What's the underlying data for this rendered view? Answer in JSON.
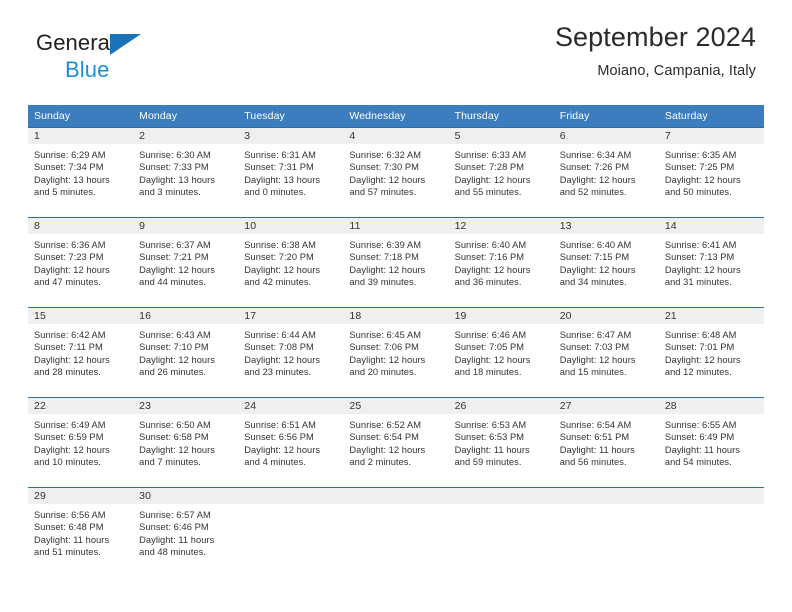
{
  "brand": {
    "name_part1": "General",
    "name_part2": "Blue",
    "triangle_color": "#1a72b8",
    "blue_text_color": "#1a8fdc"
  },
  "header": {
    "title": "September 2024",
    "subtitle": "Moiano, Campania, Italy"
  },
  "theme": {
    "header_bg": "#3c7dbf",
    "row_border": "#2e6da4",
    "daynum_bg": "#efefef",
    "text": "#333333"
  },
  "columns": [
    "Sunday",
    "Monday",
    "Tuesday",
    "Wednesday",
    "Thursday",
    "Friday",
    "Saturday"
  ],
  "labels": {
    "sunrise": "Sunrise:",
    "sunset": "Sunset:",
    "daylight": "Daylight:"
  },
  "weeks": [
    [
      {
        "day": "1",
        "sunrise": "Sunrise: 6:29 AM",
        "sunset": "Sunset: 7:34 PM",
        "daylight1": "Daylight: 13 hours",
        "daylight2": "and 5 minutes."
      },
      {
        "day": "2",
        "sunrise": "Sunrise: 6:30 AM",
        "sunset": "Sunset: 7:33 PM",
        "daylight1": "Daylight: 13 hours",
        "daylight2": "and 3 minutes."
      },
      {
        "day": "3",
        "sunrise": "Sunrise: 6:31 AM",
        "sunset": "Sunset: 7:31 PM",
        "daylight1": "Daylight: 13 hours",
        "daylight2": "and 0 minutes."
      },
      {
        "day": "4",
        "sunrise": "Sunrise: 6:32 AM",
        "sunset": "Sunset: 7:30 PM",
        "daylight1": "Daylight: 12 hours",
        "daylight2": "and 57 minutes."
      },
      {
        "day": "5",
        "sunrise": "Sunrise: 6:33 AM",
        "sunset": "Sunset: 7:28 PM",
        "daylight1": "Daylight: 12 hours",
        "daylight2": "and 55 minutes."
      },
      {
        "day": "6",
        "sunrise": "Sunrise: 6:34 AM",
        "sunset": "Sunset: 7:26 PM",
        "daylight1": "Daylight: 12 hours",
        "daylight2": "and 52 minutes."
      },
      {
        "day": "7",
        "sunrise": "Sunrise: 6:35 AM",
        "sunset": "Sunset: 7:25 PM",
        "daylight1": "Daylight: 12 hours",
        "daylight2": "and 50 minutes."
      }
    ],
    [
      {
        "day": "8",
        "sunrise": "Sunrise: 6:36 AM",
        "sunset": "Sunset: 7:23 PM",
        "daylight1": "Daylight: 12 hours",
        "daylight2": "and 47 minutes."
      },
      {
        "day": "9",
        "sunrise": "Sunrise: 6:37 AM",
        "sunset": "Sunset: 7:21 PM",
        "daylight1": "Daylight: 12 hours",
        "daylight2": "and 44 minutes."
      },
      {
        "day": "10",
        "sunrise": "Sunrise: 6:38 AM",
        "sunset": "Sunset: 7:20 PM",
        "daylight1": "Daylight: 12 hours",
        "daylight2": "and 42 minutes."
      },
      {
        "day": "11",
        "sunrise": "Sunrise: 6:39 AM",
        "sunset": "Sunset: 7:18 PM",
        "daylight1": "Daylight: 12 hours",
        "daylight2": "and 39 minutes."
      },
      {
        "day": "12",
        "sunrise": "Sunrise: 6:40 AM",
        "sunset": "Sunset: 7:16 PM",
        "daylight1": "Daylight: 12 hours",
        "daylight2": "and 36 minutes."
      },
      {
        "day": "13",
        "sunrise": "Sunrise: 6:40 AM",
        "sunset": "Sunset: 7:15 PM",
        "daylight1": "Daylight: 12 hours",
        "daylight2": "and 34 minutes."
      },
      {
        "day": "14",
        "sunrise": "Sunrise: 6:41 AM",
        "sunset": "Sunset: 7:13 PM",
        "daylight1": "Daylight: 12 hours",
        "daylight2": "and 31 minutes."
      }
    ],
    [
      {
        "day": "15",
        "sunrise": "Sunrise: 6:42 AM",
        "sunset": "Sunset: 7:11 PM",
        "daylight1": "Daylight: 12 hours",
        "daylight2": "and 28 minutes."
      },
      {
        "day": "16",
        "sunrise": "Sunrise: 6:43 AM",
        "sunset": "Sunset: 7:10 PM",
        "daylight1": "Daylight: 12 hours",
        "daylight2": "and 26 minutes."
      },
      {
        "day": "17",
        "sunrise": "Sunrise: 6:44 AM",
        "sunset": "Sunset: 7:08 PM",
        "daylight1": "Daylight: 12 hours",
        "daylight2": "and 23 minutes."
      },
      {
        "day": "18",
        "sunrise": "Sunrise: 6:45 AM",
        "sunset": "Sunset: 7:06 PM",
        "daylight1": "Daylight: 12 hours",
        "daylight2": "and 20 minutes."
      },
      {
        "day": "19",
        "sunrise": "Sunrise: 6:46 AM",
        "sunset": "Sunset: 7:05 PM",
        "daylight1": "Daylight: 12 hours",
        "daylight2": "and 18 minutes."
      },
      {
        "day": "20",
        "sunrise": "Sunrise: 6:47 AM",
        "sunset": "Sunset: 7:03 PM",
        "daylight1": "Daylight: 12 hours",
        "daylight2": "and 15 minutes."
      },
      {
        "day": "21",
        "sunrise": "Sunrise: 6:48 AM",
        "sunset": "Sunset: 7:01 PM",
        "daylight1": "Daylight: 12 hours",
        "daylight2": "and 12 minutes."
      }
    ],
    [
      {
        "day": "22",
        "sunrise": "Sunrise: 6:49 AM",
        "sunset": "Sunset: 6:59 PM",
        "daylight1": "Daylight: 12 hours",
        "daylight2": "and 10 minutes."
      },
      {
        "day": "23",
        "sunrise": "Sunrise: 6:50 AM",
        "sunset": "Sunset: 6:58 PM",
        "daylight1": "Daylight: 12 hours",
        "daylight2": "and 7 minutes."
      },
      {
        "day": "24",
        "sunrise": "Sunrise: 6:51 AM",
        "sunset": "Sunset: 6:56 PM",
        "daylight1": "Daylight: 12 hours",
        "daylight2": "and 4 minutes."
      },
      {
        "day": "25",
        "sunrise": "Sunrise: 6:52 AM",
        "sunset": "Sunset: 6:54 PM",
        "daylight1": "Daylight: 12 hours",
        "daylight2": "and 2 minutes."
      },
      {
        "day": "26",
        "sunrise": "Sunrise: 6:53 AM",
        "sunset": "Sunset: 6:53 PM",
        "daylight1": "Daylight: 11 hours",
        "daylight2": "and 59 minutes."
      },
      {
        "day": "27",
        "sunrise": "Sunrise: 6:54 AM",
        "sunset": "Sunset: 6:51 PM",
        "daylight1": "Daylight: 11 hours",
        "daylight2": "and 56 minutes."
      },
      {
        "day": "28",
        "sunrise": "Sunrise: 6:55 AM",
        "sunset": "Sunset: 6:49 PM",
        "daylight1": "Daylight: 11 hours",
        "daylight2": "and 54 minutes."
      }
    ],
    [
      {
        "day": "29",
        "sunrise": "Sunrise: 6:56 AM",
        "sunset": "Sunset: 6:48 PM",
        "daylight1": "Daylight: 11 hours",
        "daylight2": "and 51 minutes."
      },
      {
        "day": "30",
        "sunrise": "Sunrise: 6:57 AM",
        "sunset": "Sunset: 6:46 PM",
        "daylight1": "Daylight: 11 hours",
        "daylight2": "and 48 minutes."
      },
      {
        "day": "",
        "sunrise": "",
        "sunset": "",
        "daylight1": "",
        "daylight2": ""
      },
      {
        "day": "",
        "sunrise": "",
        "sunset": "",
        "daylight1": "",
        "daylight2": ""
      },
      {
        "day": "",
        "sunrise": "",
        "sunset": "",
        "daylight1": "",
        "daylight2": ""
      },
      {
        "day": "",
        "sunrise": "",
        "sunset": "",
        "daylight1": "",
        "daylight2": ""
      },
      {
        "day": "",
        "sunrise": "",
        "sunset": "",
        "daylight1": "",
        "daylight2": ""
      }
    ]
  ]
}
